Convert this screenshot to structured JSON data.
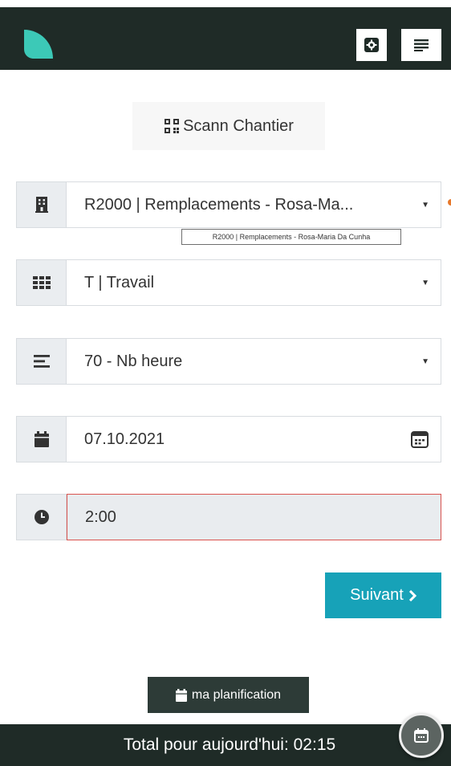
{
  "header": {
    "logo_icon": "leaf-logo",
    "settings_icon": "gear-icon",
    "menu_icon": "menu-lines-icon",
    "background": "#1f2b27",
    "logo_color": "#3cc9b7"
  },
  "scan": {
    "label": "Scann Chantier",
    "icon": "qr-code-icon"
  },
  "form": {
    "project": {
      "icon": "building-icon",
      "value": "R2000 | Remplacements - Rosa-Ma...",
      "tooltip": "R2000 | Remplacements - Rosa-Maria Da Cunha"
    },
    "activity": {
      "icon": "grid-icon",
      "value": "T | Travail"
    },
    "type": {
      "icon": "bars-icon",
      "value": "70 - Nb heure"
    },
    "date": {
      "icon": "calendar-icon",
      "value": "07.10.2021",
      "picker_icon": "calendar-picker-icon"
    },
    "time": {
      "icon": "clock-icon",
      "value": "2:00",
      "error_color": "#d9534f"
    }
  },
  "actions": {
    "next_label": "Suivant",
    "next_icon": "chevron-right-icon",
    "next_color": "#17a2b8",
    "planning_label": "ma planification",
    "planning_icon": "calendar-icon"
  },
  "footer": {
    "total_label": "Total pour aujourd'hui: 02:15",
    "fab_icon": "calendar-icon"
  }
}
